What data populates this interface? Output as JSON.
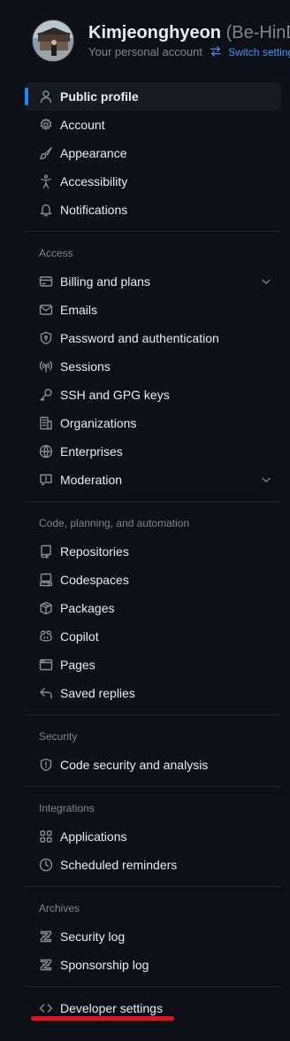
{
  "header": {
    "name": "Kimjeonghyeon",
    "handle": "(Be-HinD)",
    "subtitle": "Your personal account",
    "switch_link": "Switch settings context"
  },
  "nav": {
    "top": [
      {
        "label": "Public profile",
        "icon": "person-icon"
      },
      {
        "label": "Account",
        "icon": "gear-icon"
      },
      {
        "label": "Appearance",
        "icon": "paintbrush-icon"
      },
      {
        "label": "Accessibility",
        "icon": "accessibility-icon"
      },
      {
        "label": "Notifications",
        "icon": "bell-icon"
      }
    ],
    "access_title": "Access",
    "access": [
      {
        "label": "Billing and plans",
        "icon": "credit-card-icon"
      },
      {
        "label": "Emails",
        "icon": "mail-icon"
      },
      {
        "label": "Password and authentication",
        "icon": "shield-lock-icon"
      },
      {
        "label": "Sessions",
        "icon": "broadcast-icon"
      },
      {
        "label": "SSH and GPG keys",
        "icon": "key-icon"
      },
      {
        "label": "Organizations",
        "icon": "organization-icon"
      },
      {
        "label": "Enterprises",
        "icon": "globe-icon"
      },
      {
        "label": "Moderation",
        "icon": "report-icon"
      }
    ],
    "code_title": "Code, planning, and automation",
    "code": [
      {
        "label": "Repositories",
        "icon": "repo-icon"
      },
      {
        "label": "Codespaces",
        "icon": "codespaces-icon"
      },
      {
        "label": "Packages",
        "icon": "package-icon"
      },
      {
        "label": "Copilot",
        "icon": "copilot-icon"
      },
      {
        "label": "Pages",
        "icon": "browser-icon"
      },
      {
        "label": "Saved replies",
        "icon": "reply-icon"
      }
    ],
    "security_title": "Security",
    "security": [
      {
        "label": "Code security and analysis",
        "icon": "shield-icon"
      }
    ],
    "integrations_title": "Integrations",
    "integrations": [
      {
        "label": "Applications",
        "icon": "apps-icon"
      },
      {
        "label": "Scheduled reminders",
        "icon": "clock-icon"
      }
    ],
    "archives_title": "Archives",
    "archives": [
      {
        "label": "Security log",
        "icon": "log-icon"
      },
      {
        "label": "Sponsorship log",
        "icon": "log-icon"
      }
    ],
    "developer": {
      "label": "Developer settings",
      "icon": "code-icon"
    }
  },
  "colors": {
    "background": "#0d1117",
    "accent": "#2f81f7",
    "highlight_underline": "#e3121b"
  }
}
